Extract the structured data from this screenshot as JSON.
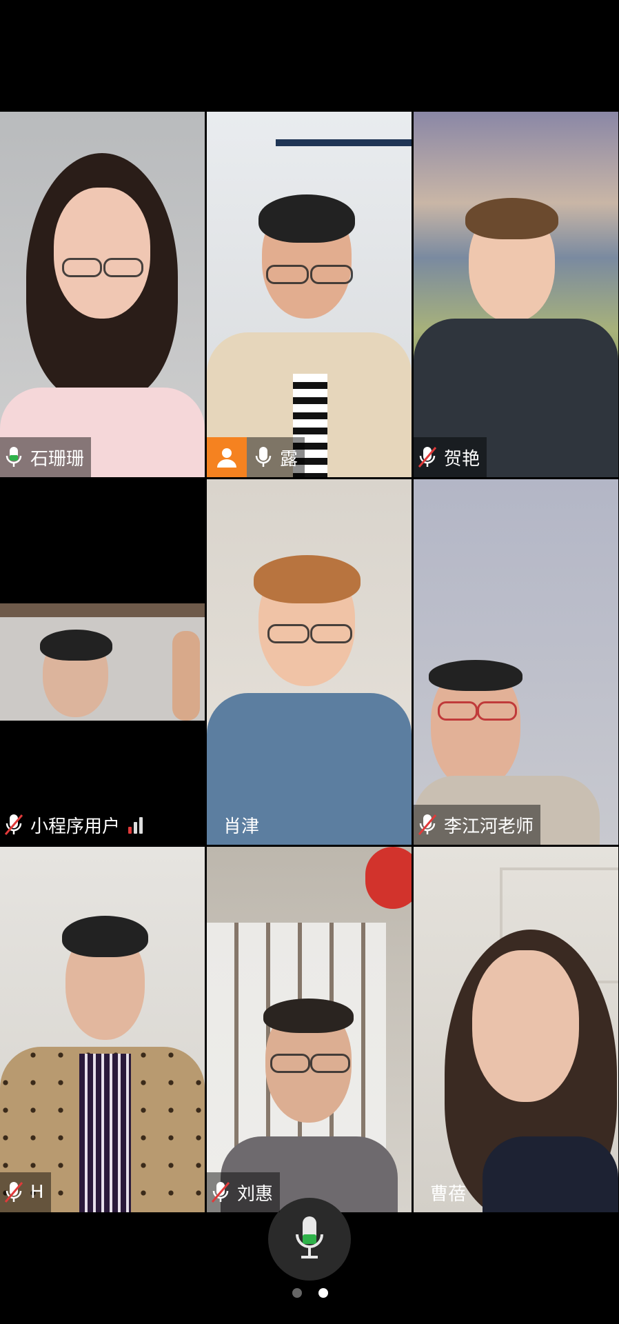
{
  "participants": [
    {
      "name": "石珊珊",
      "mic": "on",
      "speaking": true,
      "video": true
    },
    {
      "name": "露",
      "mic": "on",
      "speaking": false,
      "video": true,
      "avatar_badge": "person-icon",
      "badge_color": "#f58220"
    },
    {
      "name": "贺艳",
      "mic": "muted",
      "speaking": false,
      "video": true
    },
    {
      "name": "小程序用户",
      "mic": "muted",
      "speaking": false,
      "video": true,
      "signal": "weak"
    },
    {
      "name": "肖津",
      "mic": "none",
      "speaking": false,
      "video": true
    },
    {
      "name": "李江河老师",
      "mic": "muted",
      "speaking": false,
      "video": true
    },
    {
      "name": "H",
      "mic": "muted",
      "speaking": false,
      "video": true
    },
    {
      "name": "刘惠",
      "mic": "muted",
      "speaking": false,
      "video": true
    },
    {
      "name": "曹蓓",
      "mic": "none",
      "speaking": false,
      "video": true
    }
  ],
  "controls": {
    "main_mic": "microphone-icon",
    "main_mic_level_color": "#2fb24a"
  },
  "pager": {
    "pages": 2,
    "current": 2
  },
  "colors": {
    "active_border": "#2fb24a",
    "muted_slash": "#e03a3a",
    "badge": "#f58220"
  }
}
